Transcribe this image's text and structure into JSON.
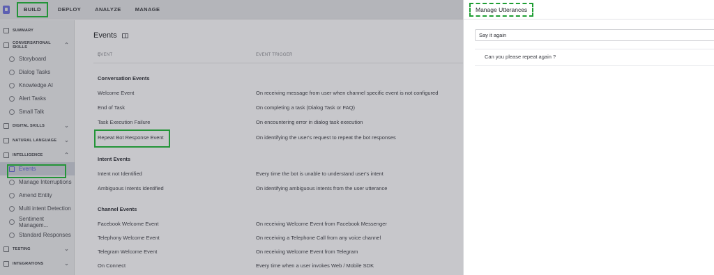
{
  "topnav": [
    "BUILD",
    "DEPLOY",
    "ANALYZE",
    "MANAGE"
  ],
  "sidebar": {
    "summary": "SUMMARY",
    "conversational_skills": "CONVERSATIONAL SKILLS",
    "conv_items": [
      "Storyboard",
      "Dialog Tasks",
      "Knowledge AI",
      "Alert Tasks",
      "Small Talk"
    ],
    "digital_skills": "DIGITAL SKILLS",
    "natural_language": "NATURAL LANGUAGE",
    "intelligence": "INTELLIGENCE",
    "intel_items": [
      "Events",
      "Manage Interruptions",
      "Amend Entity",
      "Multi intent Detection",
      "Sentiment Managem...",
      "Standard Responses"
    ],
    "testing": "TESTING",
    "integrations": "INTEGRATIONS"
  },
  "main": {
    "title": "Events",
    "col_event": "EVENT",
    "col_trigger": "EVENT TRIGGER",
    "groups": [
      {
        "name": "Conversation Events",
        "rows": [
          {
            "event": "Welcome Event",
            "trigger": "On receiving message from user when channel specific event is not configured"
          },
          {
            "event": "End of Task",
            "trigger": "On completing a task (Dialog Task or FAQ)"
          },
          {
            "event": "Task Execution Failure",
            "trigger": "On encountering error in dialog task execution"
          },
          {
            "event": "Repeat Bot Response Event",
            "trigger": "On identifying the user's request to repeat the bot responses"
          }
        ]
      },
      {
        "name": "Intent Events",
        "rows": [
          {
            "event": "Intent not Identified",
            "trigger": "Every time the bot is unable to understand user's intent"
          },
          {
            "event": "Ambiguous Intents Identified",
            "trigger": "On identifying ambiguous intents from the user utterance"
          }
        ]
      },
      {
        "name": "Channel Events",
        "rows": [
          {
            "event": "Facebook Welcome Event",
            "trigger": "On receiving Welcome Event from Facebook Messenger"
          },
          {
            "event": "Telephony Welcome Event",
            "trigger": "On receiving a Telephone Call from any voice channel"
          },
          {
            "event": "Telegram Welcome Event",
            "trigger": "On receiving Welcome Event from Telegram"
          },
          {
            "event": "On Connect",
            "trigger": "Every time when a user invokes Web / Mobile SDK"
          }
        ]
      }
    ]
  },
  "panel": {
    "title": "Manage Utterances",
    "input_value": "Say it again",
    "utterances": [
      "Can you please repeat again ?"
    ]
  },
  "colors": {
    "highlight": "#22b33a",
    "accent": "#5b5fce"
  }
}
